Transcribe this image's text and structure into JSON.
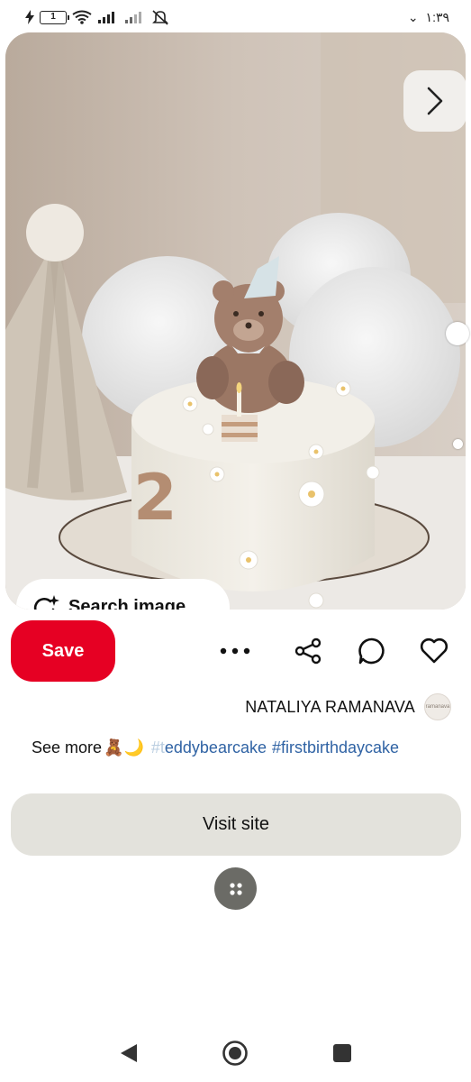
{
  "status_bar": {
    "time": "۱:۳۹",
    "battery_level": "1",
    "icons": [
      "charging-icon",
      "battery-icon",
      "wifi-icon",
      "signal-icon",
      "signal-icon",
      "muted-bell-icon",
      "data-arrow-icon"
    ]
  },
  "pin": {
    "image_icons": {
      "next": "chevron-right-icon",
      "search": "visual-search-icon"
    },
    "search_image_label": "Search image",
    "carousel_dot_count": 2
  },
  "actions": {
    "save_label": "Save",
    "icons": [
      "more-icon",
      "share-icon",
      "comment-icon",
      "heart-icon"
    ]
  },
  "creator": {
    "name": "NATALIYA RAMANAVA",
    "avatar_text": "ramanava"
  },
  "description": {
    "see_more": "See more",
    "emoji": "🧸🌙",
    "hashtag_faded": "#t",
    "hashtag_partial": "eddybearcake",
    "hashtag_2": "#firstbirthdaycake"
  },
  "visit_site_label": "Visit site",
  "fab_icon": "four-dots-icon",
  "nav": {
    "icons": [
      "back-icon",
      "home-icon",
      "recents-icon"
    ]
  },
  "colors": {
    "save": "#e60023",
    "visit_site_bg": "#e3e2dc",
    "hashtag": "#3063a4",
    "fab": "#6b6b66"
  }
}
